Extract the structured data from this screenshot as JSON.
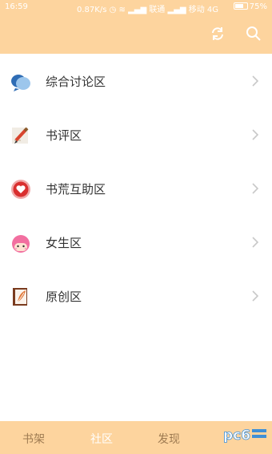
{
  "status": {
    "time": "16:59",
    "network": "0.87K/s",
    "carrier1": "联通",
    "carrier2": "移动 4G",
    "battery": "75%"
  },
  "header": {
    "refresh_icon": "refresh-icon",
    "search_icon": "search-icon"
  },
  "forums": [
    {
      "label": "综合讨论区",
      "icon": "chat-bubbles-icon"
    },
    {
      "label": "书评区",
      "icon": "pencil-note-icon"
    },
    {
      "label": "书荒互助区",
      "icon": "heart-icon"
    },
    {
      "label": "女生区",
      "icon": "girl-face-icon"
    },
    {
      "label": "原创区",
      "icon": "notebook-feather-icon"
    }
  ],
  "tabs": [
    {
      "label": "书架",
      "active": false
    },
    {
      "label": "社区",
      "active": true
    },
    {
      "label": "发现",
      "active": false
    }
  ],
  "watermark": "pc6",
  "colors": {
    "accent": "#fdd49e",
    "tab_inactive": "#9e7b52",
    "text": "#333333"
  }
}
